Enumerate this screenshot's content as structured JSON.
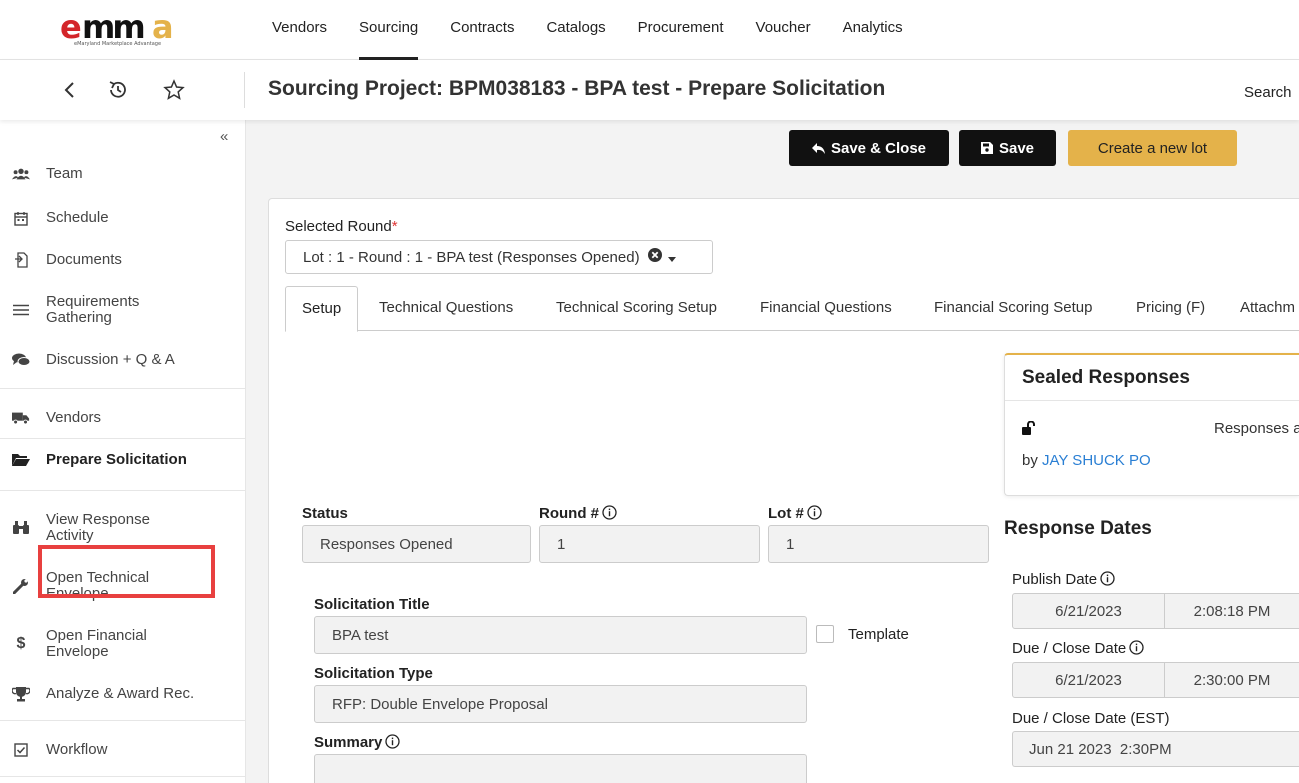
{
  "logo": {
    "text": "emma",
    "tagline": "eMaryland Marketplace Advantage"
  },
  "topnav": [
    "Vendors",
    "Sourcing",
    "Contracts",
    "Catalogs",
    "Procurement",
    "Voucher",
    "Analytics"
  ],
  "header": {
    "title": "Sourcing Project: BPM038183 - BPA test - Prepare Solicitation",
    "search_label": "Search"
  },
  "sidebar": {
    "collapse": "«",
    "items": [
      {
        "label": "Team",
        "icon": "users-icon"
      },
      {
        "label": "Schedule",
        "icon": "calendar-icon"
      },
      {
        "label": "Documents",
        "icon": "document-icon"
      },
      {
        "label": "Requirements\nGathering",
        "icon": "list-icon"
      },
      {
        "label": "Discussion + Q & A",
        "icon": "comments-icon"
      },
      {
        "label": "Vendors",
        "icon": "truck-icon"
      },
      {
        "label": "Prepare Solicitation",
        "icon": "folder-open-icon"
      },
      {
        "label": "View Response\nActivity",
        "icon": "binoculars-icon"
      },
      {
        "label": "Open Technical\nEnvelope",
        "icon": "wrench-icon"
      },
      {
        "label": "Open Financial\nEnvelope",
        "icon": "dollar-icon"
      },
      {
        "label": "Analyze & Award Rec.",
        "icon": "trophy-icon"
      },
      {
        "label": "Workflow",
        "icon": "checkbox-icon"
      }
    ]
  },
  "toolbar": {
    "save_close": "Save & Close",
    "save": "Save",
    "create_lot": "Create a new lot"
  },
  "round": {
    "label": "Selected Round",
    "required": "*",
    "value": "Lot : 1 - Round : 1 - BPA test (Responses Opened)"
  },
  "tabs": [
    "Setup",
    "Technical Questions",
    "Technical Scoring Setup",
    "Financial Questions",
    "Financial Scoring Setup",
    "Pricing (F)",
    "Attachm"
  ],
  "form": {
    "status_label": "Status",
    "status_value": "Responses Opened",
    "round_label": "Round #",
    "round_value": "1",
    "lot_label": "Lot #",
    "lot_value": "1",
    "title_label": "Solicitation Title",
    "title_value": "BPA test",
    "template_label": "Template",
    "type_label": "Solicitation Type",
    "type_value": "RFP: Double Envelope Proposal",
    "summary_label": "Summary"
  },
  "sealed": {
    "title": "Sealed Responses",
    "text": "Responses a",
    "by": "by",
    "user": "JAY SHUCK PO"
  },
  "dates": {
    "title": "Response Dates",
    "publish_label": "Publish Date",
    "publish_date": "6/21/2023",
    "publish_time": "2:08:18 PM",
    "due_label": "Due / Close Date",
    "due_date": "6/21/2023",
    "due_time": "2:30:00 PM",
    "due_est_label": "Due / Close Date (EST)",
    "due_est_value": "Jun 21 2023  2:30PM"
  },
  "colors": {
    "accent_gold": "#e4b24a",
    "highlight_red": "#e8403f",
    "link_blue": "#2a7fd4"
  }
}
